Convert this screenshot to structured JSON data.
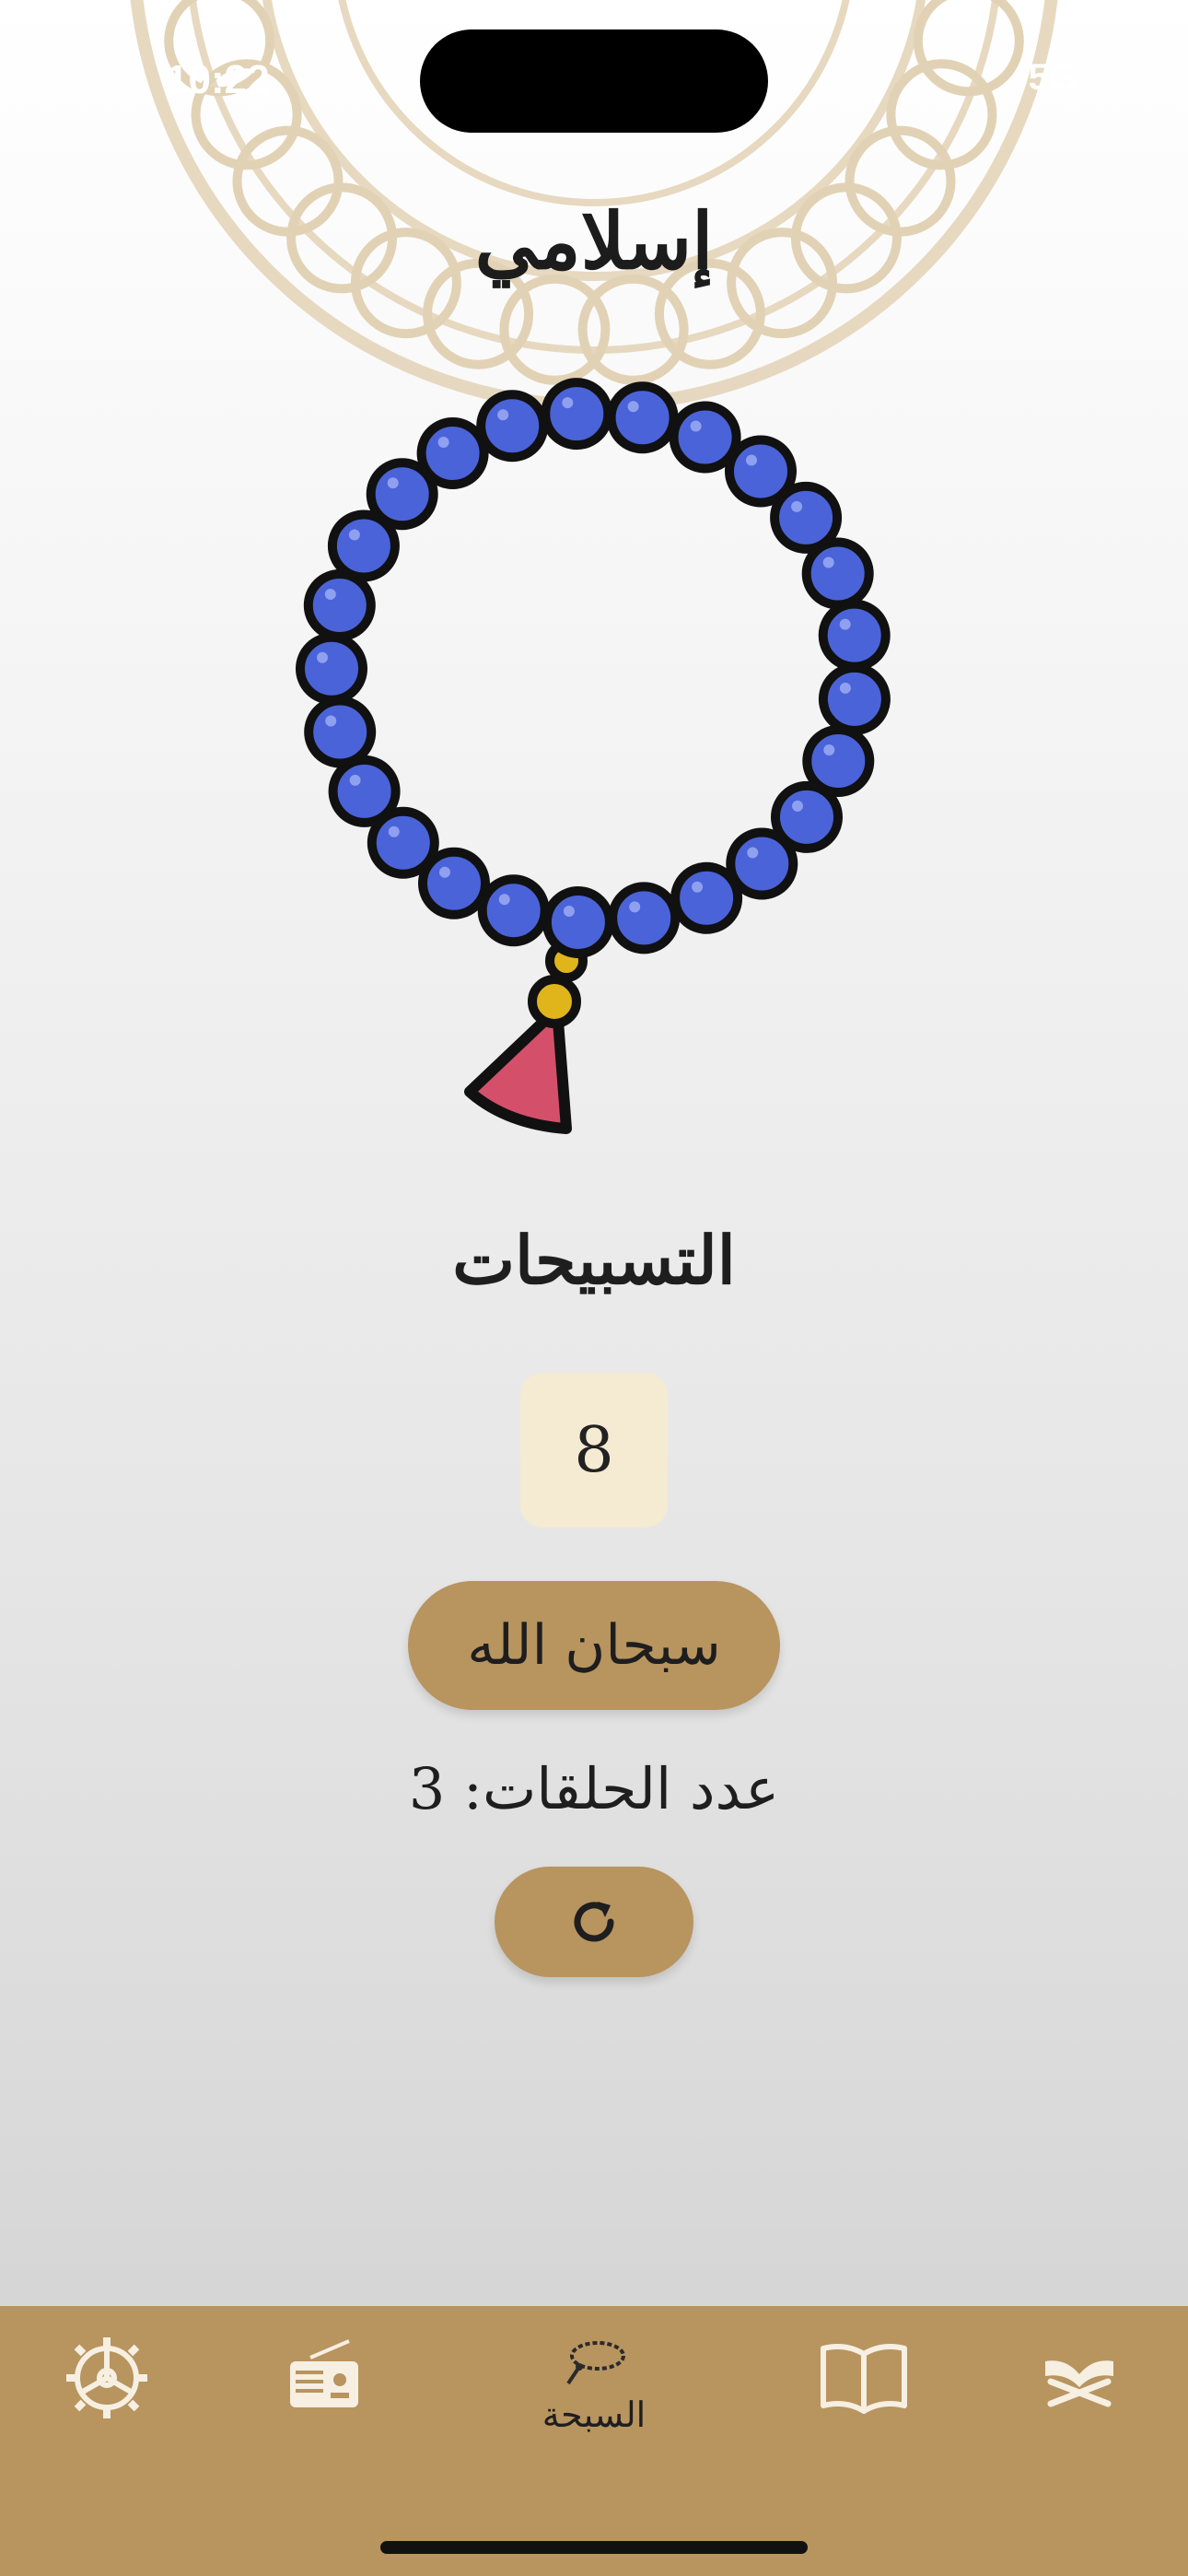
{
  "status": {
    "time": "10:22",
    "right": "5G"
  },
  "app": {
    "title": "إسلامي"
  },
  "section": {
    "title": "التسبيحات"
  },
  "counter": {
    "value": "8"
  },
  "tasbih_button": {
    "label": "سبحان الله"
  },
  "rounds": {
    "text": "عدد الحلقات: 3"
  },
  "tabbar": {
    "active_label": "السبحة",
    "items": [
      {
        "name": "settings",
        "icon": "gear-icon"
      },
      {
        "name": "radio",
        "icon": "radio-icon"
      },
      {
        "name": "sebha",
        "icon": "prayer-beads-icon",
        "label": "السبحة"
      },
      {
        "name": "hadith",
        "icon": "book-icon"
      },
      {
        "name": "quran",
        "icon": "quran-icon"
      }
    ]
  },
  "colors": {
    "accent": "#b8945f",
    "bead": "#4a63d8",
    "tassel": "#d4506a",
    "knot": "#e0b51c",
    "counter_bg": "#f5ead2"
  }
}
